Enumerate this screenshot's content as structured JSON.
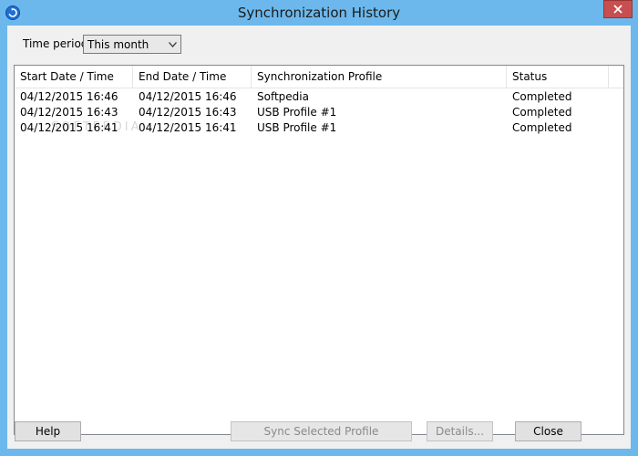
{
  "window": {
    "title": "Synchronization History"
  },
  "filter": {
    "label": "Time period:",
    "selected": "This month"
  },
  "table": {
    "columns": [
      "Start Date / Time",
      "End Date / Time",
      "Synchronization Profile",
      "Status"
    ],
    "rows": [
      [
        "04/12/2015 16:46",
        "04/12/2015 16:46",
        "Softpedia",
        "Completed"
      ],
      [
        "04/12/2015 16:43",
        "04/12/2015 16:43",
        "USB Profile #1",
        "Completed"
      ],
      [
        "04/12/2015 16:41",
        "04/12/2015 16:41",
        "USB Profile #1",
        "Completed"
      ]
    ]
  },
  "buttons": {
    "help": "Help",
    "sync_selected": "Sync Selected Profile",
    "details": "Details...",
    "close": "Close"
  },
  "watermark": "SOFTPEDIA",
  "colors": {
    "titlebar": "#6cb8ec",
    "close_button": "#c74f4f",
    "client_bg": "#f0f0f0"
  }
}
